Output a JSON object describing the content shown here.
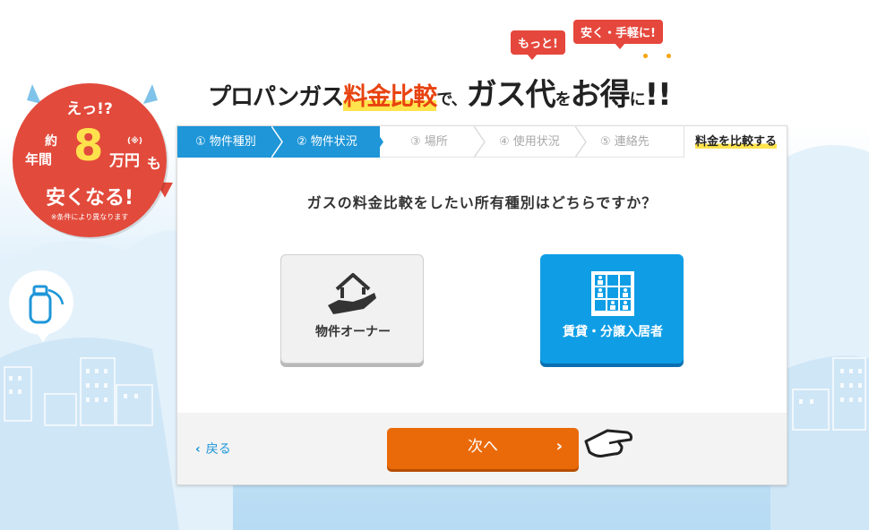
{
  "header": {
    "headline": [
      "プロパンガス",
      "料金比較",
      "で、",
      "ガス代",
      "を",
      "お得",
      "に",
      "!!"
    ],
    "bubble_left": "もっと!",
    "bubble_right": "安く・手軽に!"
  },
  "badge": {
    "line1": "えっ!?",
    "yaku": "約",
    "nenkan": "年間",
    "amount": "8",
    "unit": "万円",
    "note_mark": "(※)",
    "mo": "も",
    "line3": "安くなる!",
    "footnote": "※条件により異なります"
  },
  "steps": [
    {
      "label": "① 物件種別",
      "state": "active"
    },
    {
      "label": "② 物件状況",
      "state": "active"
    },
    {
      "label": "③ 場所",
      "state": "inactive"
    },
    {
      "label": "④ 使用状況",
      "state": "inactive"
    },
    {
      "label": "⑤ 連絡先",
      "state": "inactive"
    },
    {
      "label": "料金を比較する",
      "state": "final"
    }
  ],
  "question": "ガスの料金比較をしたい所有種別はどちらですか？",
  "choices": [
    {
      "label": "物件オーナー",
      "icon": "house-hand-icon",
      "selected": false
    },
    {
      "label": "賃貸・分譲入居者",
      "icon": "apartment-residents-icon",
      "selected": true
    }
  ],
  "nav": {
    "back_label": "戻る",
    "next_label": "次へ"
  },
  "colors": {
    "accent_blue": "#1e96d8",
    "selected_blue": "#0f9ee6",
    "next_orange": "#ea6a09",
    "badge_red": "#e24a3b",
    "highlight_yellow": "#ffe44d"
  }
}
